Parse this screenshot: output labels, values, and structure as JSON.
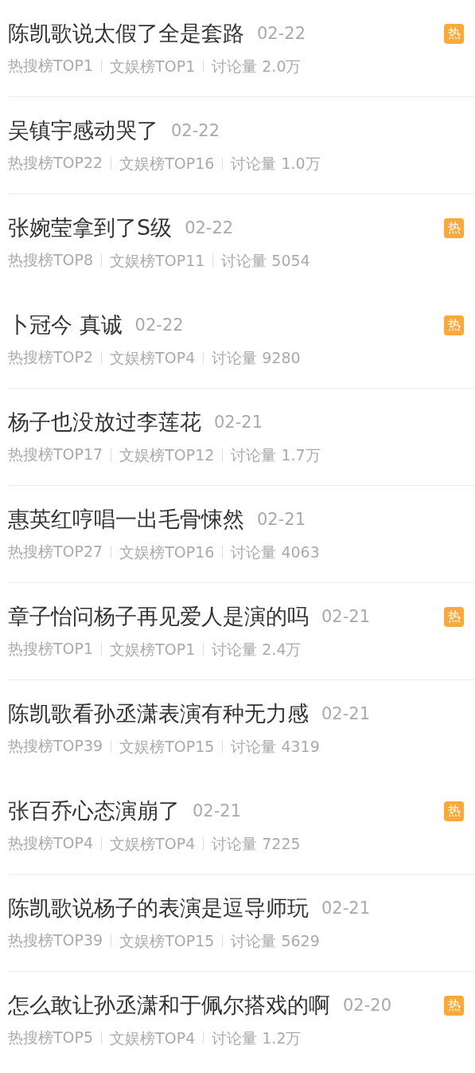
{
  "items": [
    {
      "title": "陈凯歌说太假了全是套路",
      "date": "02-22",
      "hot": true,
      "hot_label": "热",
      "meta": [
        "热搜榜TOP1",
        "文娱榜TOP1",
        "讨论量 2.0万"
      ],
      "divider_below": true
    },
    {
      "title": "吴镇宇感动哭了",
      "date": "02-22",
      "hot": false,
      "meta": [
        "热搜榜TOP22",
        "文娱榜TOP16",
        "讨论量 1.0万"
      ],
      "divider_below": true
    },
    {
      "title": "张婉莹拿到了S级",
      "date": "02-22",
      "hot": true,
      "hot_label": "热",
      "meta": [
        "热搜榜TOP8",
        "文娱榜TOP11",
        "讨论量 5054"
      ],
      "divider_below": false
    },
    {
      "title": "卜冠今 真诚",
      "date": "02-22",
      "hot": true,
      "hot_label": "热",
      "meta": [
        "热搜榜TOP2",
        "文娱榜TOP4",
        "讨论量 9280"
      ],
      "divider_below": true
    },
    {
      "title": "杨子也没放过李莲花",
      "date": "02-21",
      "hot": false,
      "meta": [
        "热搜榜TOP17",
        "文娱榜TOP12",
        "讨论量 1.7万"
      ],
      "divider_below": true
    },
    {
      "title": "惠英红哼唱一出毛骨悚然",
      "date": "02-21",
      "hot": false,
      "meta": [
        "热搜榜TOP27",
        "文娱榜TOP16",
        "讨论量 4063"
      ],
      "divider_below": true
    },
    {
      "title": "章子怡问杨子再见爱人是演的吗",
      "date": "02-21",
      "hot": true,
      "hot_label": "热",
      "meta": [
        "热搜榜TOP1",
        "文娱榜TOP1",
        "讨论量 2.4万"
      ],
      "divider_below": true
    },
    {
      "title": "陈凯歌看孙丞潇表演有种无力感",
      "date": "02-21",
      "hot": false,
      "meta": [
        "热搜榜TOP39",
        "文娱榜TOP15",
        "讨论量 4319"
      ],
      "divider_below": false
    },
    {
      "title": "张百乔心态演崩了",
      "date": "02-21",
      "hot": true,
      "hot_label": "热",
      "meta": [
        "热搜榜TOP4",
        "文娱榜TOP4",
        "讨论量 7225"
      ],
      "divider_below": true
    },
    {
      "title": "陈凯歌说杨子的表演是逗导师玩",
      "date": "02-21",
      "hot": false,
      "meta": [
        "热搜榜TOP39",
        "文娱榜TOP15",
        "讨论量 5629"
      ],
      "divider_below": true
    },
    {
      "title": "怎么敢让孙丞潇和于佩尔搭戏的啊",
      "date": "02-20",
      "hot": true,
      "hot_label": "热",
      "meta": [
        "热搜榜TOP5",
        "文娱榜TOP4",
        "讨论量 1.2万"
      ],
      "divider_below": false
    }
  ]
}
